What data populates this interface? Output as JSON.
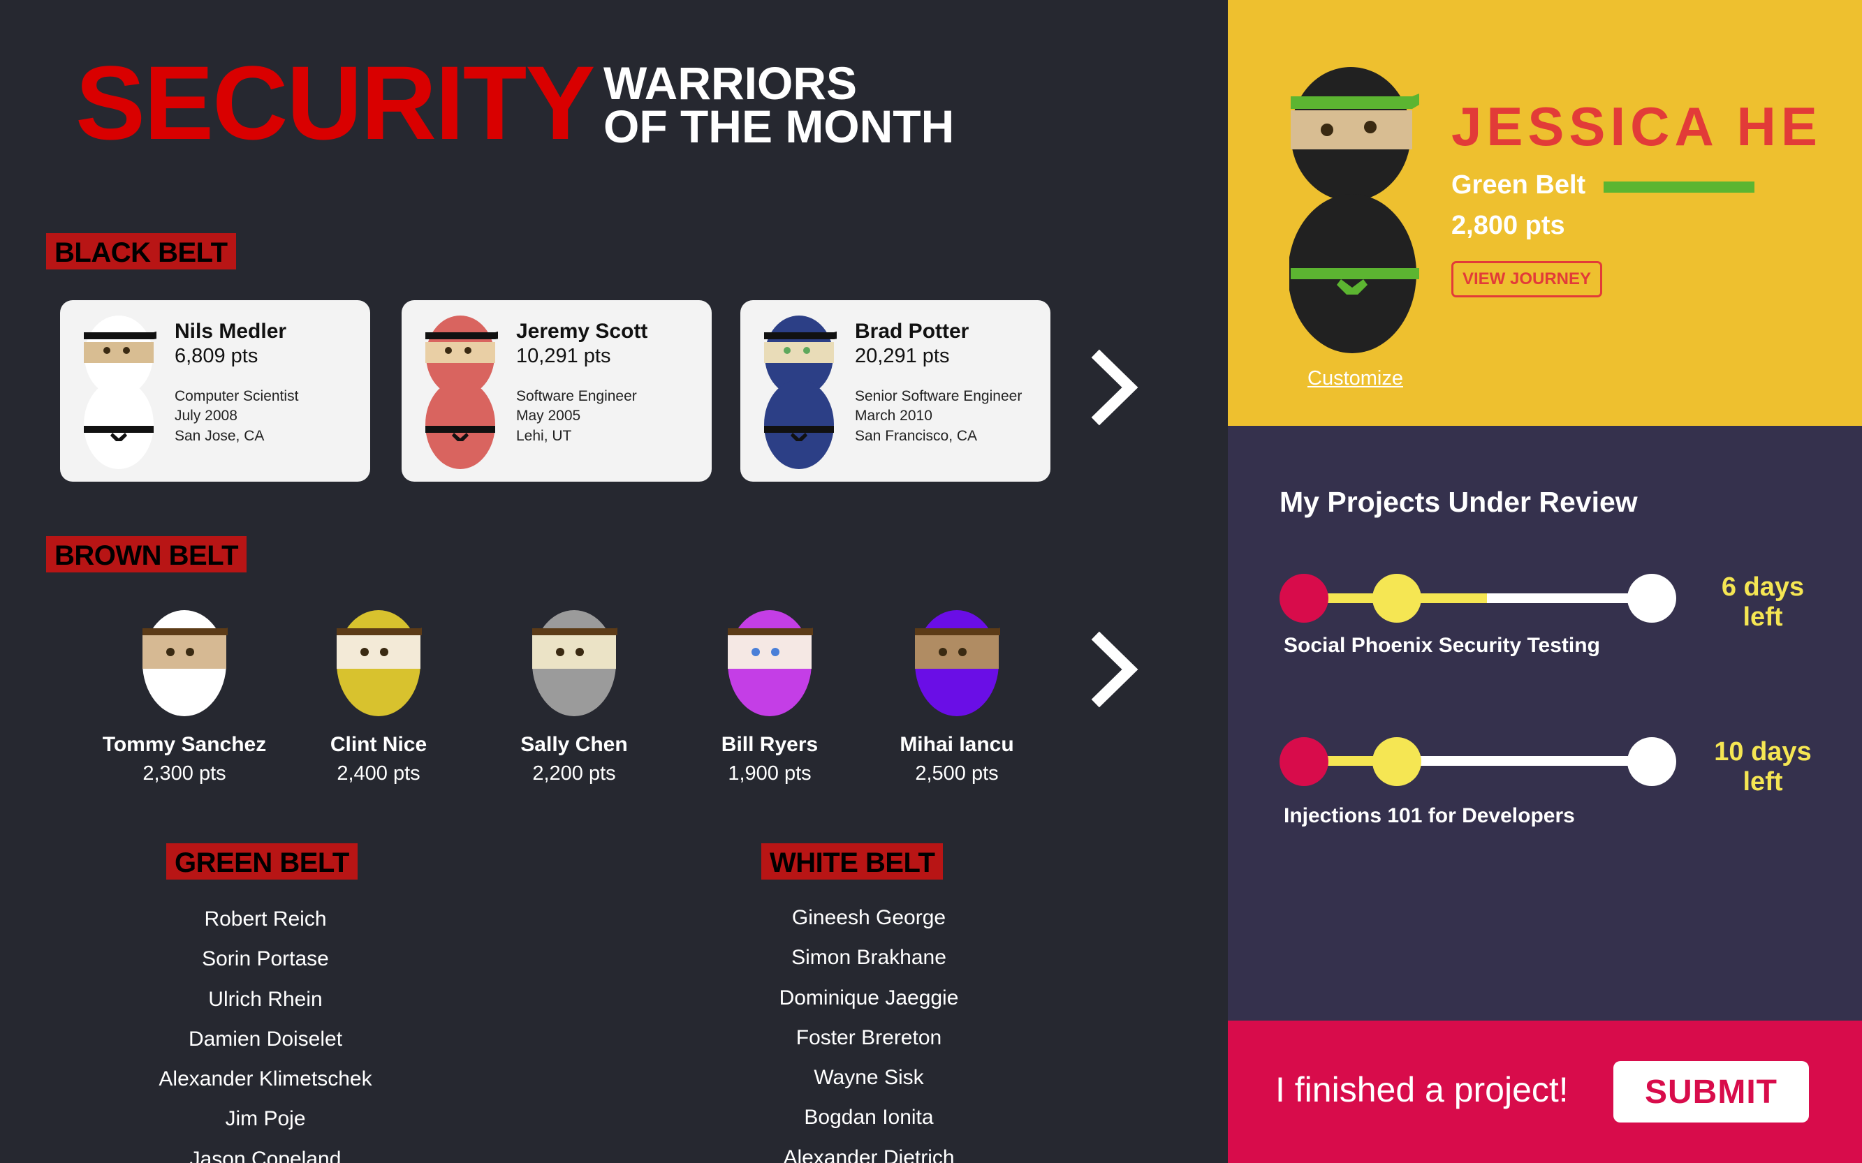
{
  "header": {
    "title_main": "SECURITY",
    "title_line1": "WARRIORS",
    "title_line2": "OF THE MONTH"
  },
  "black_belt": {
    "label": "BLACK BELT",
    "members": [
      {
        "name": "Nils Medler",
        "points": "6,809 pts",
        "role": "Computer Scientist",
        "date": "July 2008",
        "location": "San Jose, CA",
        "color": "#ffffff",
        "eye_color": "#3a2a12"
      },
      {
        "name": "Jeremy Scott",
        "points": "10,291 pts",
        "role": "Software Engineer",
        "date": "May 2005",
        "location": "Lehi, UT",
        "color": "#d9645f",
        "eye_color": "#3a2a12"
      },
      {
        "name": "Brad Potter",
        "points": "20,291 pts",
        "role": "Senior Software Engineer",
        "date": "March 2010",
        "location": "San Francisco, CA",
        "color": "#2c3f86",
        "eye_color": "#5ea85c"
      }
    ],
    "next_icon": "chevron-right-icon"
  },
  "brown_belt": {
    "label": "BROWN BELT",
    "members": [
      {
        "name": "Tommy Sanchez",
        "points": "2,300 pts",
        "color": "#ffffff",
        "eye_color": "#3a2a12"
      },
      {
        "name": "Clint Nice",
        "points": "2,400 pts",
        "color": "#d8c22e",
        "eye_color": "#3a2a12"
      },
      {
        "name": "Sally Chen",
        "points": "2,200 pts",
        "color": "#9b9b9b",
        "eye_color": "#3a2a12"
      },
      {
        "name": "Bill Ryers",
        "points": "1,900 pts",
        "color": "#c43ee6",
        "eye_color": "#4a7fd8"
      },
      {
        "name": "Mihai Iancu",
        "points": "2,500 pts",
        "color": "#6a0ee6",
        "eye_color": "#3a2a12"
      }
    ],
    "next_icon": "chevron-right-icon"
  },
  "green_belt": {
    "label": "GREEN BELT",
    "members": [
      "Robert Reich",
      "Sorin Portase",
      "Ulrich Rhein",
      "Damien Doiselet",
      "Alexander Klimetschek",
      "Jim Poje",
      "Jason Copeland"
    ]
  },
  "white_belt": {
    "label": "WHITE BELT",
    "members": [
      "Gineesh George",
      "Simon Brakhane",
      "Dominique Jaeggie",
      "Foster Brereton",
      "Wayne Sisk",
      "Bogdan Ionita",
      "Alexander Dietrich"
    ]
  },
  "profile": {
    "name": "JESSICA HE",
    "belt": "Green Belt",
    "points": "2,800 pts",
    "view_journey_label": "VIEW JOURNEY",
    "customize_label": "Customize",
    "belt_color": "#5cb531"
  },
  "projects": {
    "title": "My Projects Under Review",
    "items": [
      {
        "name": "Social Phoenix Security Testing",
        "days_line1": "6 days",
        "days_line2": "left",
        "progress": 0.53
      },
      {
        "name": "Injections 101 for Developers",
        "days_line1": "10 days",
        "days_line2": "left",
        "progress": 0.31
      }
    ]
  },
  "submit": {
    "prompt": "I finished a project!",
    "button_label": "SUBMIT"
  },
  "colors": {
    "left_bg": "#262830",
    "profile_bg": "#eec02f",
    "projects_bg": "#35314d",
    "submit_bg": "#d80c4b",
    "accent_red": "#d90000",
    "progress_yellow": "#f5e653",
    "start_dot": "#d80c4b"
  }
}
